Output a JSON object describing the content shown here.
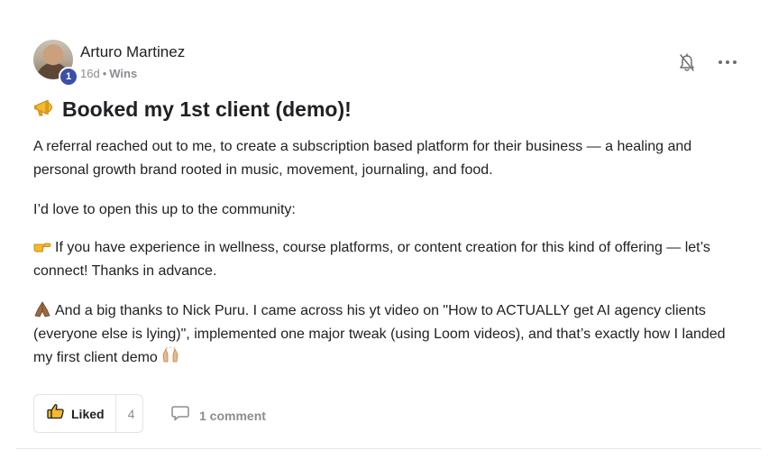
{
  "post": {
    "author": {
      "name": "Arturo Martinez",
      "level": "1",
      "time_ago": "16d",
      "separator": "•",
      "category": "Wins"
    },
    "title": "Booked my 1st client (demo)!",
    "title_icon": "megaphone-icon",
    "paragraphs": {
      "p1": "A referral reached out to me, to create a subscription based platform for their business — a healing and personal growth brand rooted in music, movement, journaling, and food.",
      "p2": "I’d love to open this up to the community:",
      "p3": "If you have experience in wellness, course platforms, or content creation for this kind of offering — let’s connect! Thanks in advance.",
      "p4": "And a big thanks to Nick Puru. I came across his yt video on \"How to ACTUALLY get AI agency clients (everyone else is lying)\", implemented one major tweak (using Loom videos), and that’s exactly how I landed my first client demo"
    },
    "icons": {
      "p3_lead": "pointing-hand-icon",
      "p4_lead": "folded-hands-icon",
      "p4_trail": "raising-hands-icon",
      "notification": "bell-off-icon",
      "more": "more-options-icon"
    },
    "actions": {
      "like_label": "Liked",
      "like_count": "4",
      "comments_label": "1 comment"
    },
    "colors": {
      "level_badge": "#3b4fa8",
      "muted_text": "#8a8d91",
      "emoji_yellow": "#f5b82e"
    }
  }
}
